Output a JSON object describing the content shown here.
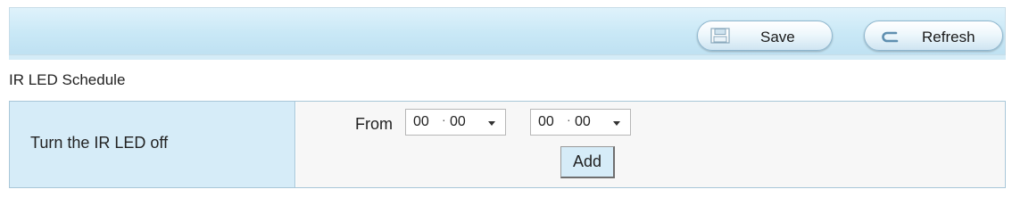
{
  "toolbar": {
    "save_label": "Save",
    "refresh_label": "Refresh",
    "save_icon": "floppy-disk-icon",
    "refresh_icon": "refresh-arrow-icon"
  },
  "section": {
    "title": "IR LED Schedule"
  },
  "schedule": {
    "row_label": "Turn the IR LED off",
    "from_label": "From",
    "start_time": {
      "hour": "00",
      "minute": "00"
    },
    "end_time": {
      "hour": "00",
      "minute": "00"
    },
    "add_label": "Add"
  },
  "colors": {
    "toolbar_bg": "#c9e8f6",
    "label_cell_bg": "#d6ecf8",
    "border": "#a9c7d8"
  }
}
